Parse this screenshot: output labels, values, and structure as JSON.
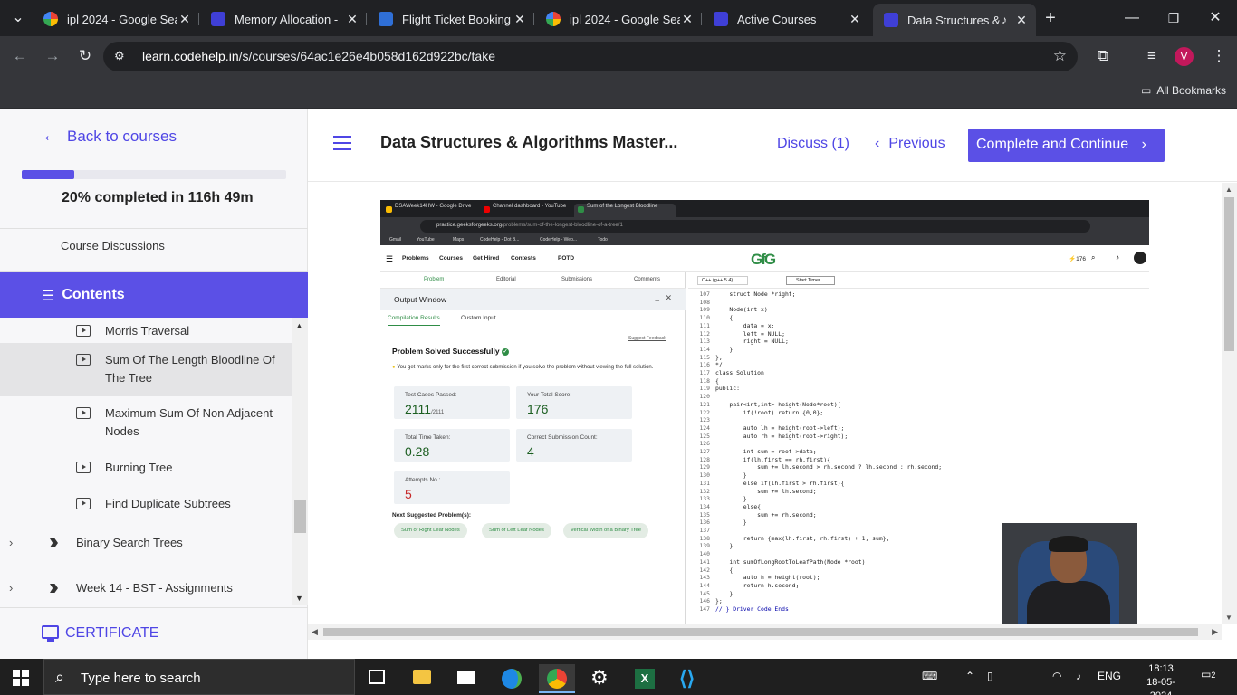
{
  "browser": {
    "tabs": [
      {
        "title": "ipl 2024 - Google Sea",
        "icon": "google-icon",
        "active": false
      },
      {
        "title": "Memory Allocation - ",
        "icon": "codehelp-icon",
        "active": false
      },
      {
        "title": "Flight Ticket Booking",
        "icon": "flight-icon",
        "active": false
      },
      {
        "title": "ipl 2024 - Google Sea",
        "icon": "google-icon",
        "active": false
      },
      {
        "title": "Active Courses",
        "icon": "codehelp-icon",
        "active": false
      },
      {
        "title": "Data Structures &",
        "icon": "codehelp-icon",
        "active": true
      }
    ],
    "url_domain": "learn.codehelp.in",
    "url_path": "/s/courses/64ac1e26e4b058d162d922bc/take",
    "profile_initial": "V",
    "all_bookmarks": "All Bookmarks"
  },
  "sidebar": {
    "back_label": "Back to courses",
    "progress_percent": 20,
    "completed_prefix": "20% completed in ",
    "completed_time": "116h 49m",
    "discussions": "Course Discussions",
    "contents_label": "Contents",
    "lessons": [
      {
        "title": "Morris Traversal",
        "selected": false
      },
      {
        "title": "Sum Of The Length Bloodline Of The Tree",
        "selected": true
      },
      {
        "title": "Maximum Sum Of Non Adjacent Nodes",
        "selected": false
      },
      {
        "title": "Burning Tree",
        "selected": false
      },
      {
        "title": "Find Duplicate Subtrees",
        "selected": false
      }
    ],
    "sections": [
      {
        "title": "Binary Search Trees"
      },
      {
        "title": "Week 14 - BST - Assignments"
      }
    ],
    "certificate": "CERTIFICATE"
  },
  "header": {
    "course_title": "Data Structures & Algorithms Master...",
    "discuss_label": "Discuss (1)",
    "previous_label": "Previous",
    "complete_label": "Complete and Continue"
  },
  "video": {
    "tabs": [
      "DSAWeek14HW - Google Drive",
      "Channel dashboard - YouTube",
      "Sum of the Longest Bloodline"
    ],
    "url_domain": "practice.geeksforgeeks.org",
    "url_path": "/problems/sum-of-the-longest-bloodline-of-a-tree/1",
    "bookmarks": [
      "Gmail",
      "YouTube",
      "Maps",
      "CodeHelp - Dot B...",
      "CodeHelp - Web...",
      "Todo"
    ],
    "site_nav": [
      "Problems",
      "Courses",
      "Get Hired",
      "Contests",
      "POTD"
    ],
    "site_logo": "GfG",
    "streak": "176",
    "problem_tabs": [
      "Problem",
      "Editorial",
      "Submissions",
      "Comments"
    ],
    "output_title": "Output Window",
    "output_tabs": [
      "Compilation Results",
      "Custom Input"
    ],
    "suggest_feedback": "Suggest Feedback",
    "solved_text": "Problem Solved Successfully",
    "tip": "You get marks only for the first correct submission if you solve the problem without viewing the full solution.",
    "stats": [
      {
        "label": "Test Cases Passed:",
        "value": "2111",
        "suffix": "/2111"
      },
      {
        "label": "Your Total Score:",
        "value": "176",
        "suffix": ""
      },
      {
        "label": "Total Time Taken:",
        "value": "0.28",
        "suffix": ""
      },
      {
        "label": "Correct Submission Count:",
        "value": "4",
        "suffix": ""
      },
      {
        "label": "Attempts No.:",
        "value": "5",
        "suffix": ""
      }
    ],
    "next_label": "Next Suggested Problem(s):",
    "suggested": [
      "Sum of Right Leaf Nodes",
      "Sum of Left Leaf Nodes",
      "Vertical Width of a Binary Tree"
    ],
    "language": "C++ (g++ 5.4)",
    "start_timer": "Start Timer",
    "code_lines": [
      {
        "n": "107",
        "t": "    struct Node *right;"
      },
      {
        "n": "108",
        "t": ""
      },
      {
        "n": "109",
        "t": "    Node(int x)"
      },
      {
        "n": "110",
        "t": "    {"
      },
      {
        "n": "111",
        "t": "        data = x;"
      },
      {
        "n": "112",
        "t": "        left = NULL;"
      },
      {
        "n": "113",
        "t": "        right = NULL;"
      },
      {
        "n": "114",
        "t": "    }"
      },
      {
        "n": "115",
        "t": "};"
      },
      {
        "n": "116",
        "t": "*/"
      },
      {
        "n": "117",
        "t": "class Solution"
      },
      {
        "n": "118",
        "t": "{"
      },
      {
        "n": "119",
        "t": "public:"
      },
      {
        "n": "120",
        "t": ""
      },
      {
        "n": "121",
        "t": "    pair<int,int> height(Node*root){"
      },
      {
        "n": "122",
        "t": "        if(!root) return {0,0};"
      },
      {
        "n": "123",
        "t": ""
      },
      {
        "n": "124",
        "t": "        auto lh = height(root->left);"
      },
      {
        "n": "125",
        "t": "        auto rh = height(root->right);"
      },
      {
        "n": "126",
        "t": ""
      },
      {
        "n": "127",
        "t": "        int sum = root->data;"
      },
      {
        "n": "128",
        "t": "        if(lh.first == rh.first){"
      },
      {
        "n": "129",
        "t": "            sum += lh.second > rh.second ? lh.second : rh.second;"
      },
      {
        "n": "130",
        "t": "        }"
      },
      {
        "n": "131",
        "t": "        else if(lh.first > rh.first){"
      },
      {
        "n": "132",
        "t": "            sum += lh.second;"
      },
      {
        "n": "133",
        "t": "        }"
      },
      {
        "n": "134",
        "t": "        else{"
      },
      {
        "n": "135",
        "t": "            sum += rh.second;"
      },
      {
        "n": "136",
        "t": "        }"
      },
      {
        "n": "137",
        "t": ""
      },
      {
        "n": "138",
        "t": "        return {max(lh.first, rh.first) + 1, sum};"
      },
      {
        "n": "139",
        "t": "    }"
      },
      {
        "n": "140",
        "t": ""
      },
      {
        "n": "141",
        "t": "    int sumOfLongRootToLeafPath(Node *root)"
      },
      {
        "n": "142",
        "t": "    {"
      },
      {
        "n": "143",
        "t": "        auto h = height(root);"
      },
      {
        "n": "144",
        "t": "        return h.second;"
      },
      {
        "n": "145",
        "t": "    }"
      },
      {
        "n": "146",
        "t": "};"
      },
      {
        "n": "147",
        "t": "// } Driver Code Ends"
      }
    ]
  },
  "taskbar": {
    "search_placeholder": "Type here to search",
    "language": "ENG",
    "time": "18:13",
    "date": "18-05-2024",
    "notifications": "2"
  },
  "colors": {
    "accent": "#5b50e6",
    "accent_text": "#4f46e5",
    "gfg_green": "#2f8d46"
  }
}
